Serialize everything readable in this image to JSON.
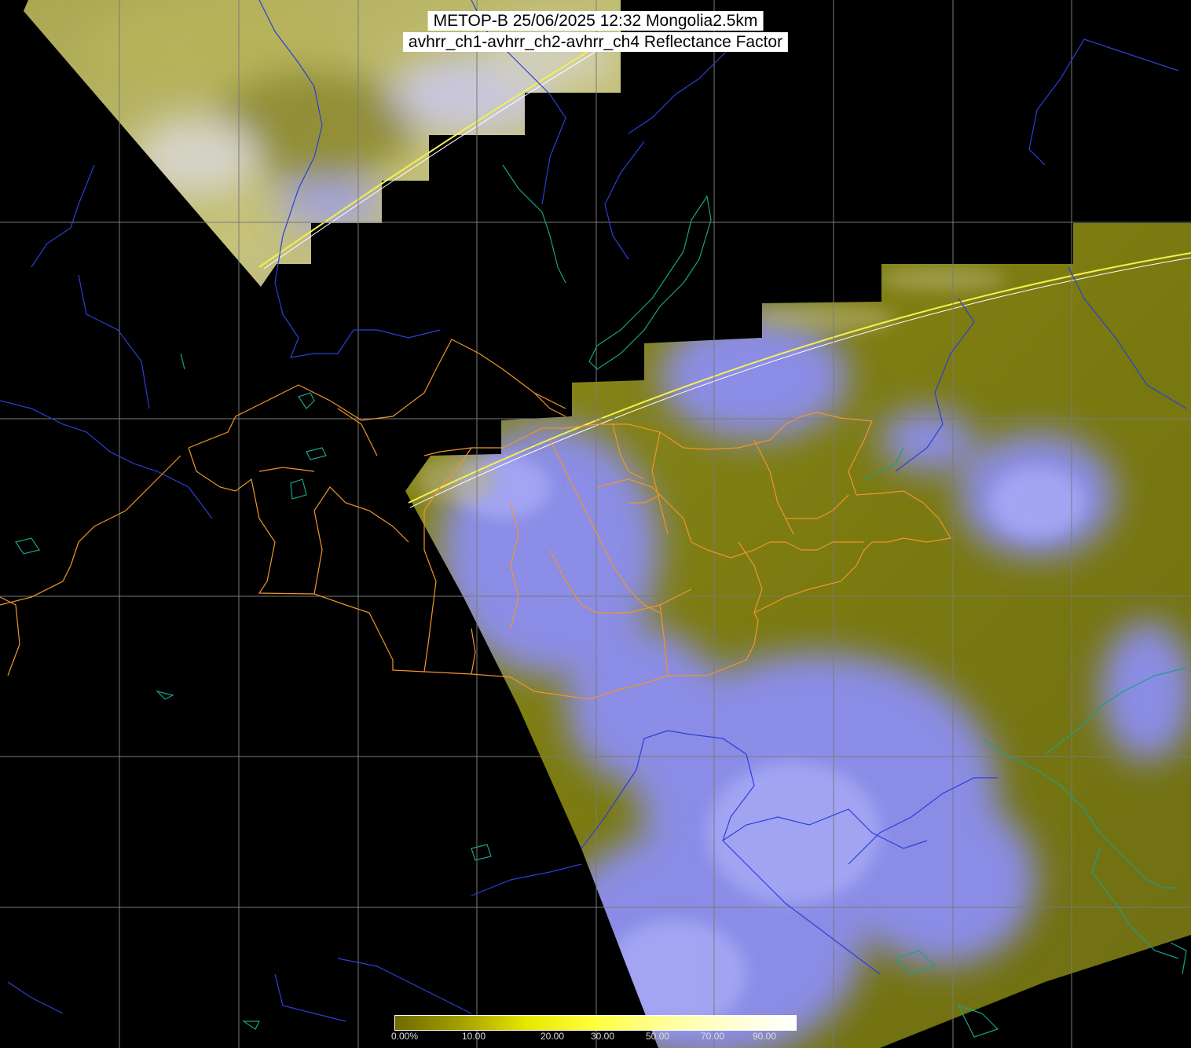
{
  "title": {
    "line1": "METOP-B 25/06/2025 12:32 Mongolia2.5km",
    "line2": "avhrr_ch1-avhrr_ch2-avhrr_ch4 Reflectance Factor"
  },
  "colorbar": {
    "labels": [
      "0.00%",
      "10.00",
      "20.00",
      "30.00",
      "50.00",
      "70.00",
      "90.00"
    ],
    "colors": [
      "#6e6a00",
      "#a6a200",
      "#e8e800",
      "#ffff40",
      "#ffff9a",
      "#ffffd0",
      "#ffffff"
    ]
  },
  "colors": {
    "background": "#000000",
    "graticule": "#7a7a7a",
    "rivers": "#2b3fd8",
    "coast": "#1aa08a",
    "borders": "#f0962a",
    "land_swath": "#7b7a10",
    "cloud": "#8a8cf0",
    "swath_stripe": "#f4f050"
  }
}
